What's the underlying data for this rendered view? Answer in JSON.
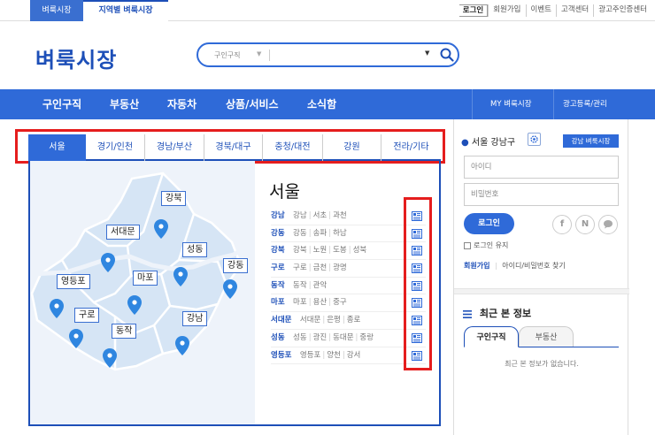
{
  "top": {
    "tabs": [
      "벼룩시장",
      "지역별 벼룩시장"
    ],
    "util": [
      "로그인",
      "회원가입",
      "이벤트",
      "고객센터",
      "광고주인증센터"
    ]
  },
  "logo": "벼룩시장",
  "search": {
    "select_label": "구인구직",
    "value": ""
  },
  "nav": {
    "items": [
      "구인구직",
      "부동산",
      "자동차",
      "상품/서비스",
      "소식함"
    ],
    "right": [
      "MY 벼룩시장",
      "광고등록/관리"
    ]
  },
  "regions": {
    "tabs": [
      "서울",
      "경기/인천",
      "경남/부산",
      "경북/대구",
      "충청/대전",
      "강원",
      "전라/기타"
    ],
    "active": 0
  },
  "map_labels": [
    "강북",
    "서대문",
    "성동",
    "강동",
    "영등포",
    "마포",
    "구로",
    "동작",
    "강남"
  ],
  "city": "서울",
  "districts": [
    {
      "main": "강남",
      "subs": [
        "강남",
        "서초",
        "과천"
      ]
    },
    {
      "main": "강동",
      "subs": [
        "강동",
        "송파",
        "하남"
      ]
    },
    {
      "main": "강북",
      "subs": [
        "강북",
        "노원",
        "도봉",
        "성북"
      ]
    },
    {
      "main": "구로",
      "subs": [
        "구로",
        "금천",
        "광명"
      ]
    },
    {
      "main": "동작",
      "subs": [
        "동작",
        "관악"
      ]
    },
    {
      "main": "마포",
      "subs": [
        "마포",
        "용산",
        "중구"
      ]
    },
    {
      "main": "서대문",
      "subs": [
        "서대문",
        "은평",
        "종로"
      ]
    },
    {
      "main": "성동",
      "subs": [
        "성동",
        "광진",
        "동대문",
        "중랑"
      ]
    },
    {
      "main": "영등포",
      "subs": [
        "영등포",
        "양천",
        "강서"
      ]
    }
  ],
  "sidebar": {
    "location": "서울 강남구",
    "regional_button": "강남 벼룩시장",
    "id_placeholder": "아이디",
    "pw_placeholder": "비밀번호",
    "login_button": "로그인",
    "keep_login": "로그인 유지",
    "join": "회원가입",
    "find": "아이디/비밀번호 찾기",
    "social": [
      "f",
      "N",
      "talk-icon"
    ],
    "recent_title": "최근 본 정보",
    "recent_tabs": [
      "구인구직",
      "부동산"
    ],
    "empty_text": "최근 본 정보가 없습니다."
  },
  "colors": {
    "primary": "#2f6ad8",
    "dark": "#1d4fb8",
    "highlight": "#e51d1d",
    "pin": "#2f86e0"
  }
}
